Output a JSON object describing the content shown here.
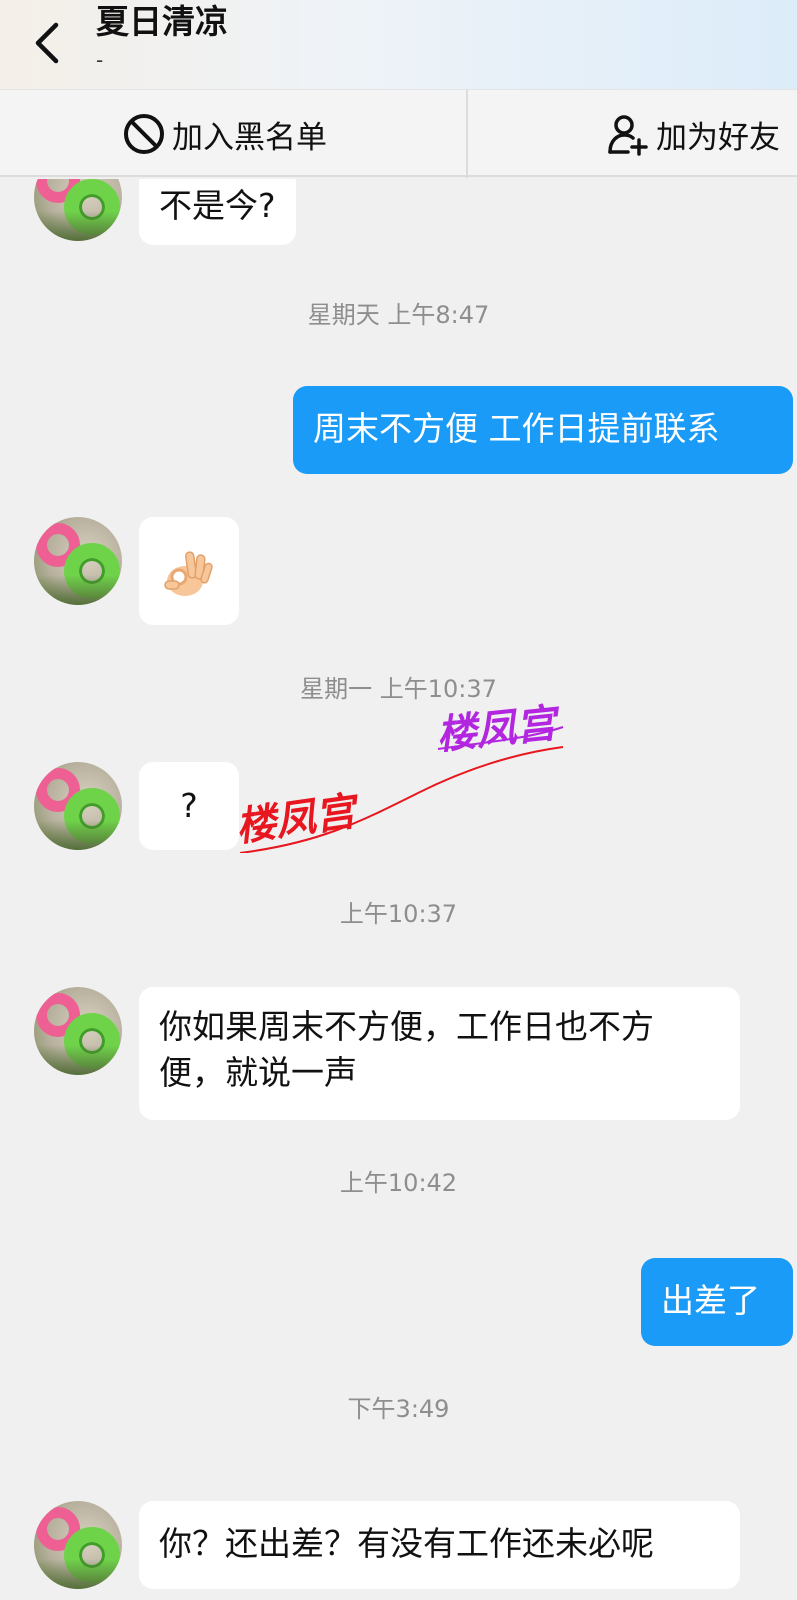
{
  "header": {
    "title": "夏日清凉",
    "subtitle": "-"
  },
  "actions": {
    "block_label": "加入黑名单",
    "add_friend_label": "加为好友"
  },
  "messages": [
    {
      "direction": "in",
      "text": "不是今?"
    },
    {
      "type": "time",
      "text": "星期天 上午8:47"
    },
    {
      "direction": "out",
      "text": "周末不方便 工作日提前联系"
    },
    {
      "direction": "in",
      "type": "emoji",
      "emoji": "ok-hand"
    },
    {
      "type": "time",
      "text": "星期一 上午10:37"
    },
    {
      "direction": "in",
      "text": "?"
    },
    {
      "type": "time",
      "text": "上午10:37"
    },
    {
      "direction": "in",
      "text_line1": "你如果周末不方便，工作日也不方",
      "text_line2": "便，就说一声"
    },
    {
      "type": "time",
      "text": "上午10:42"
    },
    {
      "direction": "out",
      "text": "出差了"
    },
    {
      "type": "time",
      "text": "下午3:49"
    },
    {
      "direction": "in",
      "text": "你？还出差？有没有工作还未必呢"
    }
  ],
  "watermark": {
    "text1": "楼凤宫",
    "text2": "楼凤宫",
    "color1": "#e8161e",
    "color2": "#b226e0"
  },
  "icons": {
    "back": "chevron-left-icon",
    "block": "prohibited-icon",
    "add_friend": "user-plus-icon"
  },
  "colors": {
    "outgoing_bubble": "#1a9bf7",
    "incoming_bubble": "#ffffff",
    "background": "#f0f0f0"
  }
}
